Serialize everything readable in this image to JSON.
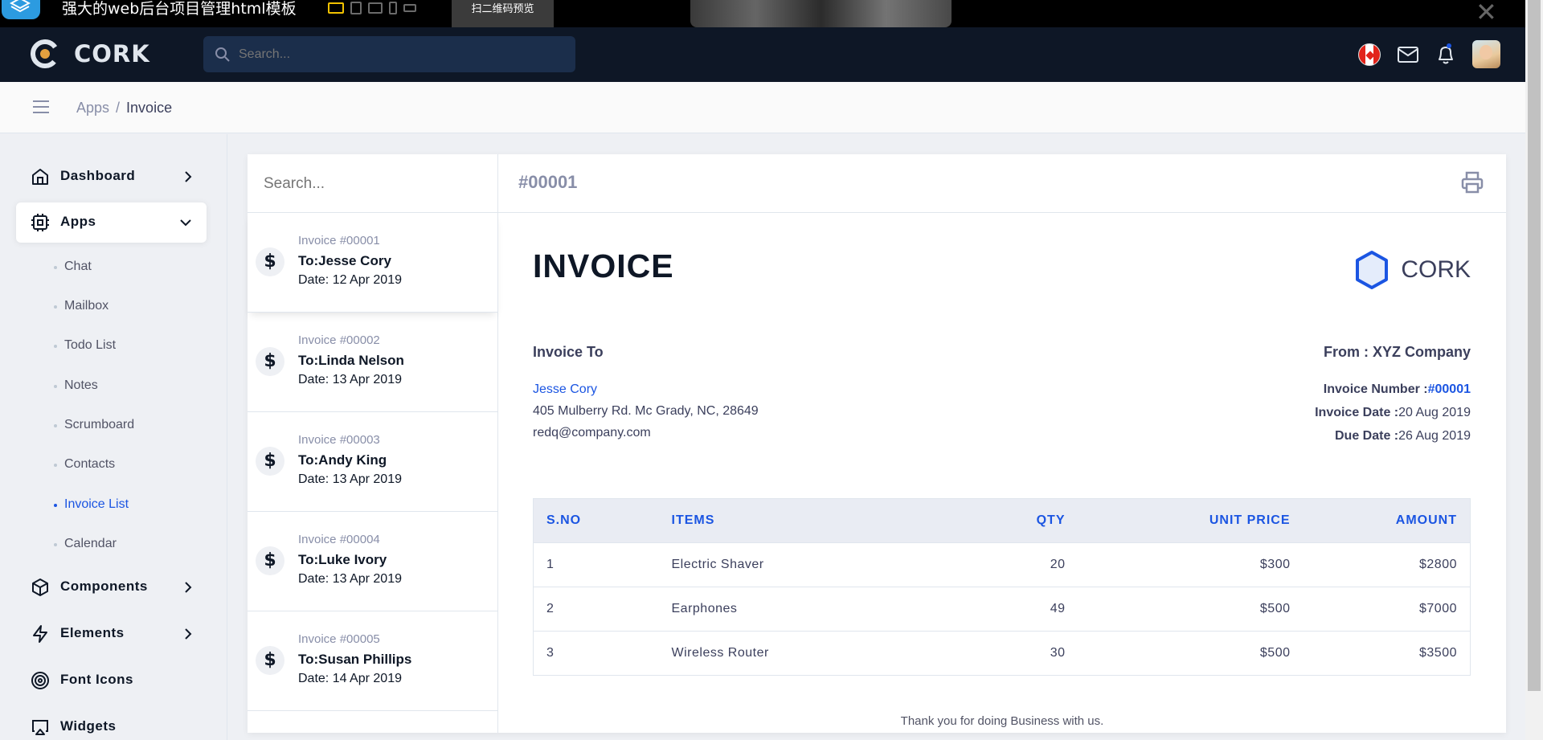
{
  "preview": {
    "title": "强大的web后台项目管理html模板",
    "qr_label": "扫二维码预览"
  },
  "navbar": {
    "brand": "CORK",
    "search_placeholder": "Search..."
  },
  "breadcrumb": {
    "parent": "Apps",
    "separator": "/",
    "current": "Invoice"
  },
  "sidebar": {
    "dashboard": "Dashboard",
    "apps": "Apps",
    "apps_sub": [
      "Chat",
      "Mailbox",
      "Todo List",
      "Notes",
      "Scrumboard",
      "Contacts",
      "Invoice List",
      "Calendar"
    ],
    "components": "Components",
    "elements": "Elements",
    "font_icons": "Font Icons",
    "widgets": "Widgets"
  },
  "invoice_list": {
    "search_placeholder": "Search...",
    "items": [
      {
        "number": "Invoice #00001",
        "to": "To:Jesse Cory",
        "date": "Date: 12 Apr 2019"
      },
      {
        "number": "Invoice #00002",
        "to": "To:Linda Nelson",
        "date": "Date: 13 Apr 2019"
      },
      {
        "number": "Invoice #00003",
        "to": "To:Andy King",
        "date": "Date: 13 Apr 2019"
      },
      {
        "number": "Invoice #00004",
        "to": "To:Luke Ivory",
        "date": "Date: 13 Apr 2019"
      },
      {
        "number": "Invoice #00005",
        "to": "To:Susan Phillips",
        "date": "Date: 14 Apr 2019"
      }
    ]
  },
  "invoice": {
    "id": "#00001",
    "title": "INVOICE",
    "company": "CORK",
    "to_label": "Invoice To",
    "to_name": "Jesse Cory",
    "to_address": "405 Mulberry Rd. Mc Grady, NC, 28649",
    "to_email": "redq@company.com",
    "from_label": "From : XYZ Company",
    "number_label": "Invoice Number :",
    "number_value": "#00001",
    "date_label": "Invoice Date :",
    "date_value": "20 Aug 2019",
    "due_label": "Due Date :",
    "due_value": "26 Aug 2019",
    "columns": [
      "S.NO",
      "ITEMS",
      "QTY",
      "UNIT PRICE",
      "AMOUNT"
    ],
    "rows": [
      [
        "1",
        "Electric Shaver",
        "20",
        "$300",
        "$2800"
      ],
      [
        "2",
        "Earphones",
        "49",
        "$500",
        "$7000"
      ],
      [
        "3",
        "Wireless Router",
        "30",
        "$500",
        "$3500"
      ]
    ],
    "thanks": "Thank you for doing Business with us."
  },
  "colors": {
    "primary": "#1b55e2",
    "navbar": "#0e1726",
    "logo_accent": "#e2a03f"
  }
}
